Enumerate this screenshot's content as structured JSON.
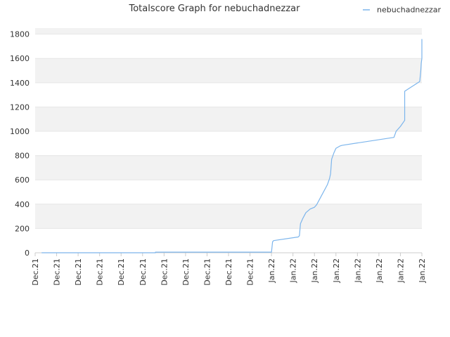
{
  "chart_data": {
    "type": "line",
    "title": "Totalscore Graph for nebuchadnezzar",
    "xlabel": "",
    "ylabel": "",
    "ylim": [
      0,
      1850
    ],
    "y_ticks": [
      0,
      200,
      400,
      600,
      800,
      1000,
      1200,
      1400,
      1600,
      1800
    ],
    "x_tick_labels": [
      "Dec.21",
      "Dec.21",
      "Dec.21",
      "Dec.21",
      "Dec.21",
      "Dec.21",
      "Dec.21",
      "Dec.21",
      "Dec.21",
      "Dec.21",
      "Dec.21",
      "Jan.22",
      "Jan.22",
      "Jan.22",
      "Jan.22",
      "Jan.22",
      "Jan.22",
      "Jan.22",
      "Jan.22"
    ],
    "legend": {
      "position": "top-right"
    },
    "grid": true,
    "colors": {
      "line": "#7cb5ec",
      "band": "#f2f2f2",
      "grid": "#e6e6e6",
      "axis": "#cccccc"
    },
    "series": [
      {
        "name": "nebuchadnezzar",
        "x": [
          0.3,
          5.6,
          5.6,
          11.0,
          11.05,
          11.1,
          12.25,
          12.3,
          12.35,
          12.45,
          12.6,
          12.8,
          13.0,
          13.1,
          13.6,
          13.7,
          13.75,
          13.8,
          13.9,
          14.0,
          14.2,
          14.3,
          16.7,
          16.8,
          17.0,
          17.2,
          17.2,
          17.9,
          17.95,
          17.97,
          18.0,
          18.0
        ],
        "y": [
          0,
          0,
          5,
          5,
          90,
          100,
          130,
          140,
          240,
          280,
          330,
          360,
          375,
          395,
          560,
          610,
          650,
          770,
          820,
          860,
          880,
          885,
          950,
          1000,
          1040,
          1090,
          1330,
          1410,
          1500,
          1560,
          1600,
          1760
        ]
      }
    ]
  }
}
